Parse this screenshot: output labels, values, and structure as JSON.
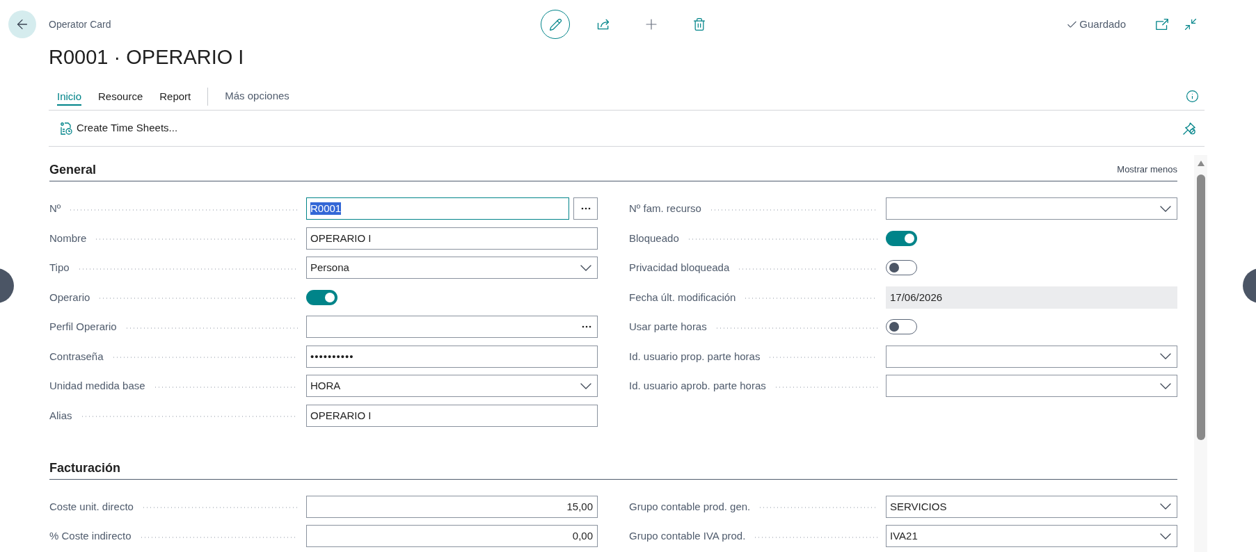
{
  "header": {
    "caption": "Operator Card",
    "title": "R0001 · OPERARIO I",
    "save_status": "Guardado"
  },
  "tabs": [
    {
      "label": "Inicio",
      "selected": true
    },
    {
      "label": "Resource",
      "selected": false
    },
    {
      "label": "Report",
      "selected": false
    }
  ],
  "more_options": "Más opciones",
  "actions": [
    {
      "label": "Create Time Sheets..."
    }
  ],
  "sections": [
    {
      "title": "General",
      "show_less": "Mostrar menos",
      "columns": [
        [
          {
            "label": "Nº",
            "kind": "assist",
            "value": "R0001",
            "focused": true
          },
          {
            "label": "Nombre",
            "kind": "text",
            "value": "OPERARIO I",
            "focused": false
          },
          {
            "label": "Tipo",
            "kind": "select",
            "value": "Persona",
            "focused": false
          },
          {
            "label": "Operario",
            "kind": "toggle",
            "on": true
          },
          {
            "label": "Perfil Operario",
            "kind": "lookup",
            "focused": false
          },
          {
            "label": "Contraseña",
            "kind": "password",
            "value": "••••••••••",
            "focused": false
          },
          {
            "label": "Unidad medida base",
            "kind": "select",
            "value": "HORA",
            "focused": false
          },
          {
            "label": "Alias",
            "kind": "text",
            "value": "OPERARIO I",
            "focused": false
          }
        ],
        [
          {
            "label": "Nº fam. recurso",
            "kind": "select",
            "focused": false
          },
          {
            "label": "Bloqueado",
            "kind": "toggle",
            "on": true
          },
          {
            "label": "Privacidad bloqueada",
            "kind": "toggle",
            "on": false
          },
          {
            "label": "Fecha últ. modificación",
            "kind": "readonly",
            "value": "17/06/2026",
            "focused": false
          },
          {
            "label": "Usar parte horas",
            "kind": "toggle",
            "on": false
          },
          {
            "label": "Id. usuario prop. parte horas",
            "kind": "select",
            "focused": false
          },
          {
            "label": "Id. usuario aprob. parte horas",
            "kind": "select",
            "focused": false
          }
        ]
      ]
    },
    {
      "title": "Facturación",
      "columns": [
        [
          {
            "label": "Coste unit. directo",
            "kind": "number",
            "value": "15,00",
            "focused": false
          },
          {
            "label": "% Coste indirecto",
            "kind": "number",
            "value": "0,00",
            "focused": false
          }
        ],
        [
          {
            "label": "Grupo contable prod. gen.",
            "kind": "select",
            "value": "SERVICIOS",
            "focused": false
          },
          {
            "label": "Grupo contable IVA prod.",
            "kind": "select",
            "value": "IVA21",
            "focused": false
          }
        ]
      ]
    }
  ]
}
